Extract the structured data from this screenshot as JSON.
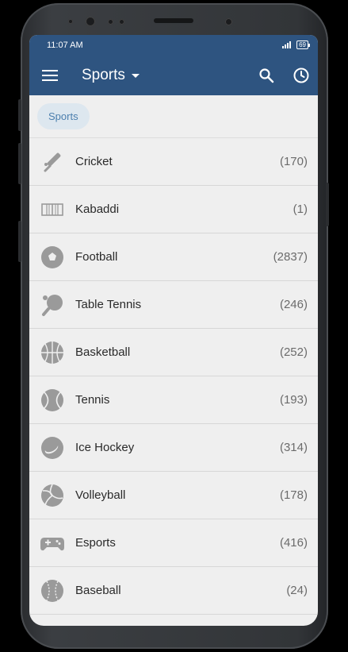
{
  "status": {
    "time": "11:07 AM",
    "battery": "69"
  },
  "appbar": {
    "title": "Sports",
    "icons": [
      "menu-icon",
      "search-icon",
      "clock-icon"
    ]
  },
  "filter_chip": "Sports",
  "sports": [
    {
      "name": "Cricket",
      "count": "(170)",
      "icon": "cricket-icon"
    },
    {
      "name": "Kabaddi",
      "count": "(1)",
      "icon": "kabaddi-icon"
    },
    {
      "name": "Football",
      "count": "(2837)",
      "icon": "football-icon"
    },
    {
      "name": "Table Tennis",
      "count": "(246)",
      "icon": "table-tennis-icon"
    },
    {
      "name": "Basketball",
      "count": "(252)",
      "icon": "basketball-icon"
    },
    {
      "name": "Tennis",
      "count": "(193)",
      "icon": "tennis-icon"
    },
    {
      "name": "Ice Hockey",
      "count": "(314)",
      "icon": "ice-hockey-icon"
    },
    {
      "name": "Volleyball",
      "count": "(178)",
      "icon": "volleyball-icon"
    },
    {
      "name": "Esports",
      "count": "(416)",
      "icon": "esports-icon"
    },
    {
      "name": "Baseball",
      "count": "(24)",
      "icon": "baseball-icon"
    }
  ],
  "colors": {
    "appbar": "#2e5480",
    "icon_gray": "#9a9a9a",
    "chip_bg": "#dde7ef",
    "chip_text": "#4c7fae"
  }
}
